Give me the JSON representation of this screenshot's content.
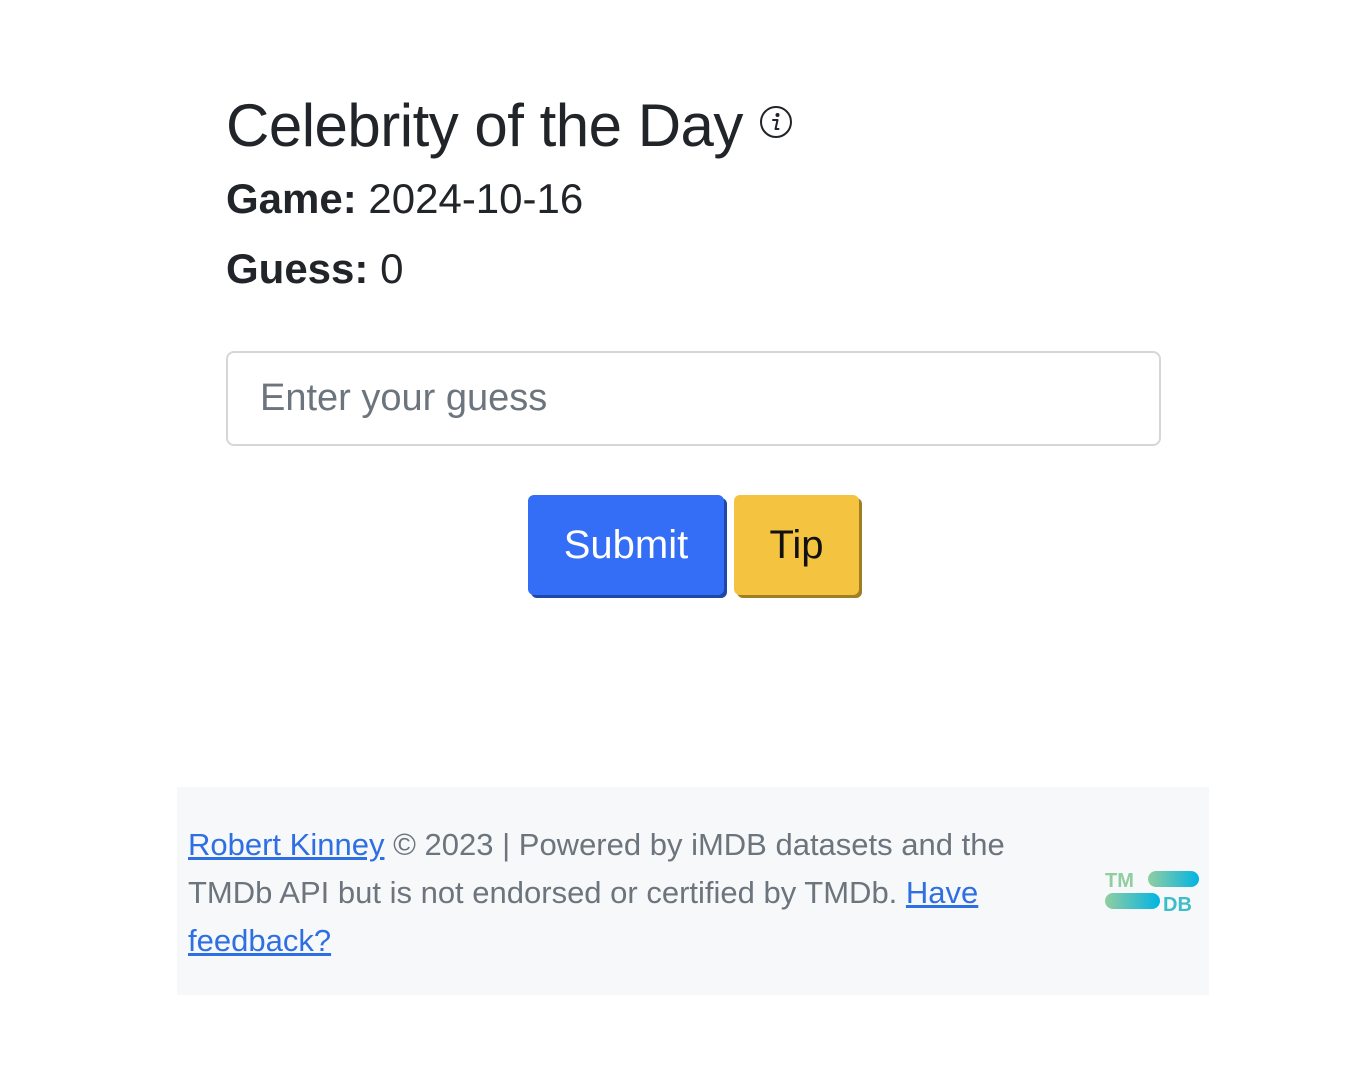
{
  "game": {
    "title": "Celebrity of the Day",
    "info_icon": "info-circle-icon",
    "game_label": "Game:",
    "game_value": "2024-10-16",
    "guess_label": "Guess:",
    "guess_value": "0"
  },
  "input": {
    "placeholder": "Enter your guess",
    "value": ""
  },
  "buttons": {
    "submit_label": "Submit",
    "tip_label": "Tip"
  },
  "footer": {
    "author_link": "Robert Kinney",
    "text_1": " © 2023 | Powered by iMDB datasets and the TMDb API but is not endorsed or certified by TMDb. ",
    "feedback_link": "Have feedback?",
    "logo": "tmdb-logo",
    "logo_text_top": "TM",
    "logo_text_bottom": "DB"
  },
  "colors": {
    "submit": "#346df6",
    "tip": "#f4c33f",
    "link": "#2f6fe4",
    "footer_bg": "#f7f8f9"
  }
}
